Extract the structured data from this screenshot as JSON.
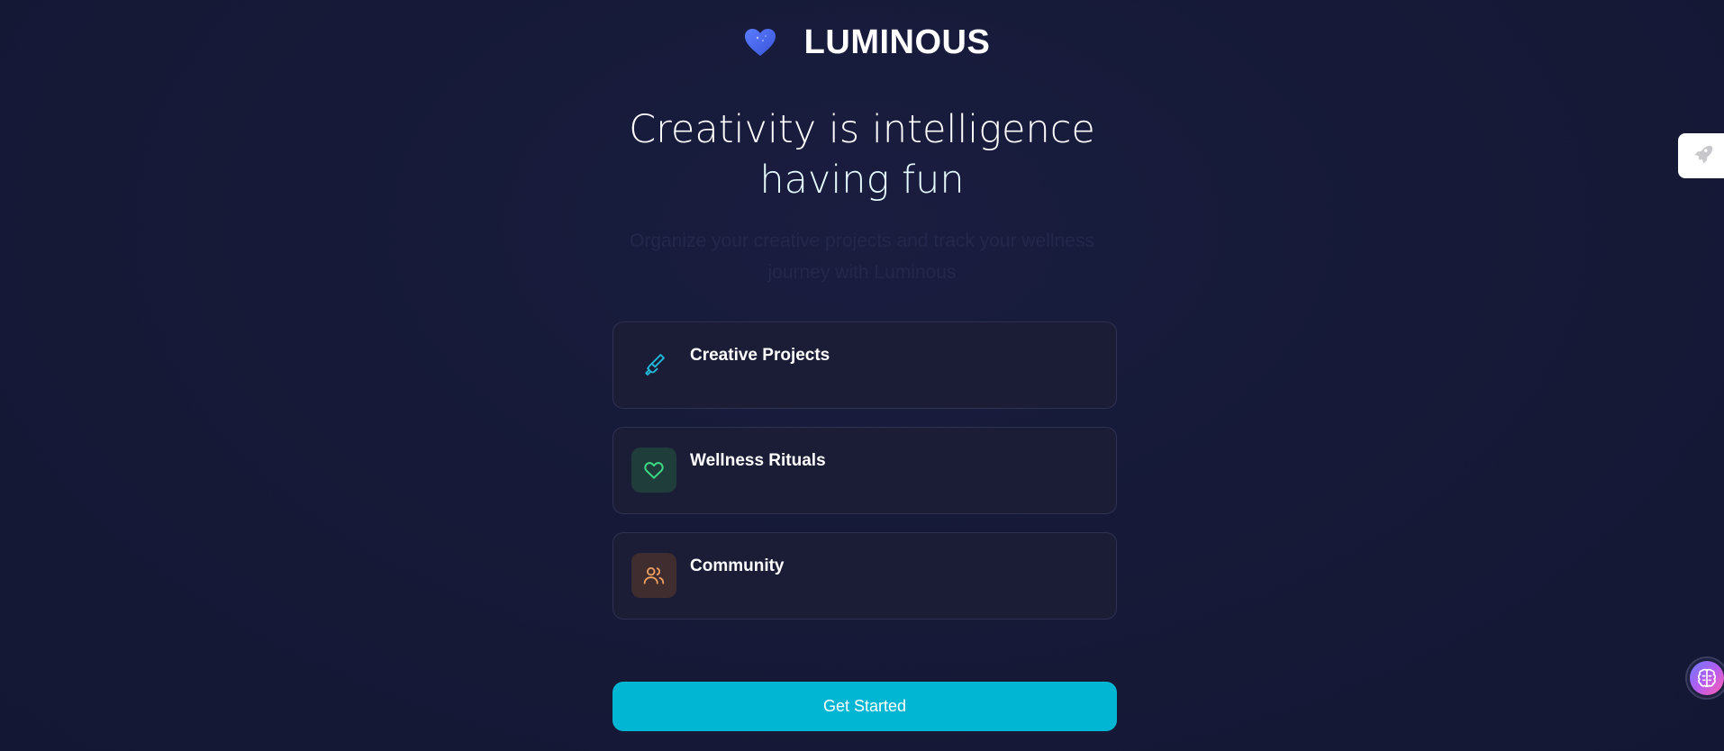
{
  "brand": {
    "name": "LUMINOUS",
    "logo_icon": "heart-logo-icon",
    "logo_color": "#4a6cf0"
  },
  "hero": {
    "headline_line1": "Creativity is intelligence",
    "headline_line2": "having fun",
    "subtitle": "Organize your creative projects and track your wellness journey with Luminous"
  },
  "features": [
    {
      "title": "Creative Projects",
      "icon": "paintbrush-icon",
      "icon_color": "#22b8d8"
    },
    {
      "title": "Wellness Rituals",
      "icon": "heart-icon",
      "icon_color": "#3ddc84"
    },
    {
      "title": "Community",
      "icon": "users-icon",
      "icon_color": "#f0a060"
    }
  ],
  "cta": {
    "label": "Get Started",
    "color": "#01b6d3"
  },
  "side_widgets": {
    "rocket_tab_icon": "rocket-icon",
    "assistant_icon": "brain-icon"
  }
}
